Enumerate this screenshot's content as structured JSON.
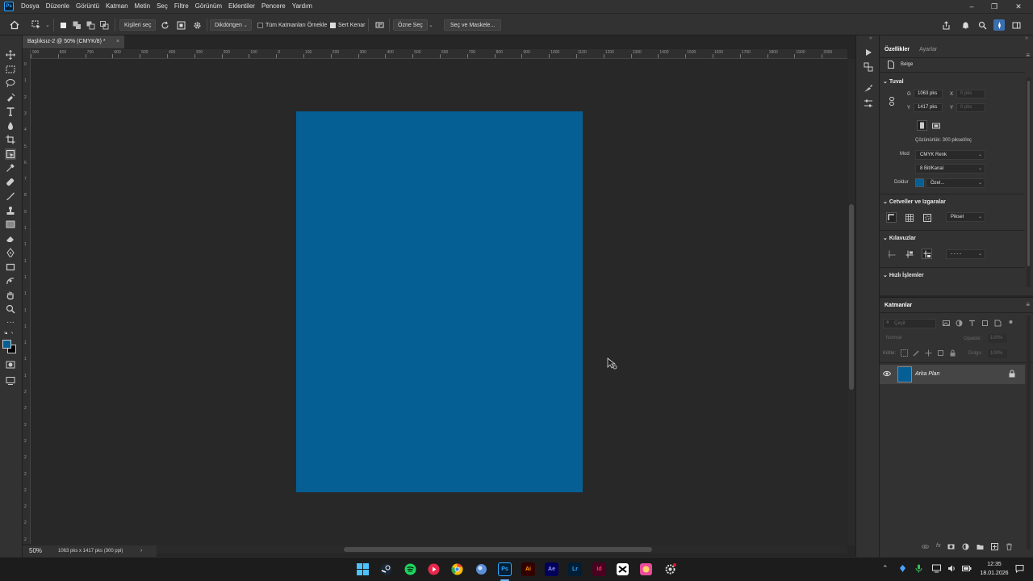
{
  "menubar": {
    "items": [
      "Dosya",
      "Düzenle",
      "Görüntü",
      "Katman",
      "Metin",
      "Seç",
      "Filtre",
      "Görünüm",
      "Eklentiler",
      "Pencere",
      "Yardım"
    ],
    "window_controls": [
      "–",
      "❐",
      "✕"
    ]
  },
  "options_bar": {
    "select_subject": "Kişileri seç",
    "shape_mode": "Dikdörtgen",
    "sample_all_layers": "Tüm Katmanları Örnekle",
    "sample_all_layers_checked": false,
    "hard_edge": "Sert Kenar",
    "hard_edge_checked": true,
    "select_subject_btn": "Özne Seç",
    "select_and_mask": "Seç ve Maskele..."
  },
  "document": {
    "tab_title": "Başlıksız-2 @ 50% (CMYK/8) *",
    "tab_close": "×",
    "fill_color": "#065f94",
    "zoom": "50%",
    "status_info": "1063 pks x 1417 pks (300 ppi)",
    "status_arrow": "›"
  },
  "rulers": {
    "top": [
      "900",
      "800",
      "700",
      "600",
      "500",
      "400",
      "300",
      "200",
      "100",
      "0",
      "100",
      "200",
      "300",
      "400",
      "500",
      "600",
      "700",
      "800",
      "900",
      "1000",
      "1100",
      "1200",
      "1300",
      "1400",
      "1500",
      "1600",
      "1700",
      "1800",
      "1900",
      "2000"
    ],
    "left": [
      "0",
      "1",
      "2",
      "3",
      "4",
      "5",
      "6",
      "7",
      "8",
      "9",
      "1",
      "1",
      "1",
      "1",
      "1",
      "1",
      "1",
      "1",
      "1",
      "1",
      "2",
      "2",
      "2",
      "2",
      "2",
      "2",
      "2",
      "2",
      "2",
      "2"
    ]
  },
  "properties": {
    "tab_active": "Özellikler",
    "tab_other": "Ayarlar",
    "doc_type": "Belge",
    "canvas_section": "Tuval",
    "w_label": "G",
    "w_value": "1063 pks",
    "h_label": "Y",
    "h_value": "1417 pks",
    "x_label": "X",
    "x_value": "0 pks",
    "y_label": "Y",
    "y_value": "0 pks",
    "resolution": "Çözünürlük: 300 piksel/inç",
    "mode_label": "Mod",
    "mode_value": "CMYK Renk",
    "bits_value": "8 Bit/Kanal",
    "fill_label": "Doldur",
    "fill_value": "Özel...",
    "fill_color": "#065f94",
    "rulers_section": "Cetveller ve Izgaralar",
    "units_value": "Piksel",
    "guides_section": "Kılavuzlar",
    "guides_style": "- - - -",
    "quick_actions": "Hızlı İşlemler"
  },
  "layers": {
    "title": "Katmanlar",
    "search_placeholder": "Çeşit",
    "blend_mode": "Normal",
    "opacity_label": "Opaklık:",
    "opacity_value": "100%",
    "lock_label": "Kilitle:",
    "fill_label": "Dolgu:",
    "fill_value": "100%",
    "layer_name": "Arka Plan",
    "layer_color": "#065f94"
  },
  "taskbar": {
    "apps": [
      "Ps",
      "Ai",
      "Ae",
      "Lr",
      "Id"
    ],
    "time": "12:35",
    "date": "18.01.2026"
  }
}
